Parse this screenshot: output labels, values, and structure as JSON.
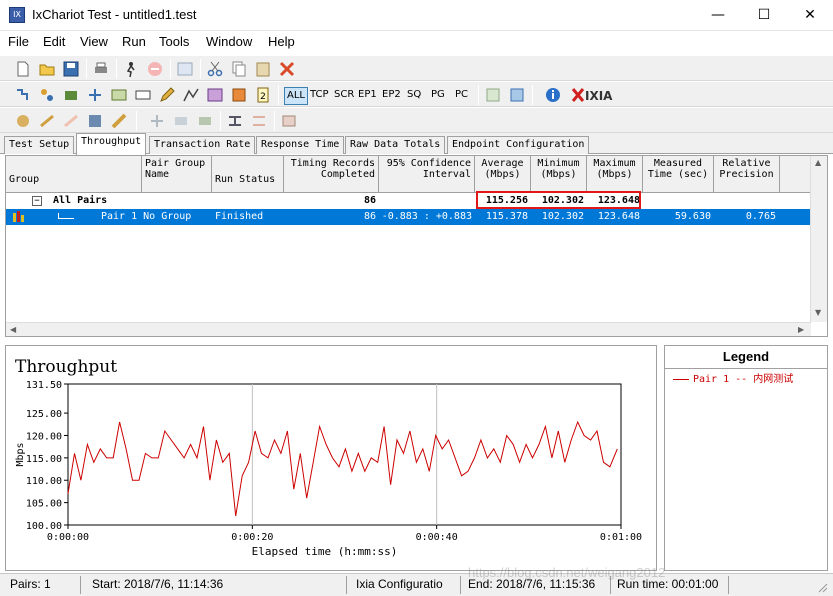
{
  "window": {
    "title": "IxChariot Test - untitled1.test",
    "icon_label": "IX",
    "minimize_glyph": "—",
    "maximize_glyph": "☐",
    "close_glyph": "✕"
  },
  "menu": [
    "File",
    "Edit",
    "View",
    "Run",
    "Tools",
    "Window",
    "Help"
  ],
  "toolbar2": {
    "filters": [
      "ALL",
      "TCP",
      "SCR",
      "EP1",
      "EP2",
      "SQ",
      "PG",
      "PC"
    ],
    "brand": "IXIA"
  },
  "tabs": [
    "Test Setup",
    "Throughput",
    "Transaction Rate",
    "Response Time",
    "Raw Data Totals",
    "Endpoint Configuration"
  ],
  "active_tab": "Throughput",
  "grid": {
    "headers": [
      "Group",
      "Pair Group\nName",
      "Run Status",
      "Timing Records\nCompleted",
      "95% Confidence\nInterval",
      "Average\n(Mbps)",
      "Minimum\n(Mbps)",
      "Maximum\n(Mbps)",
      "Measured\nTime (sec)",
      "Relative\nPrecision"
    ],
    "all_pairs": {
      "expander": "−",
      "label": "All Pairs",
      "records": "86",
      "average": "115.256",
      "minimum": "102.302",
      "maximum": "123.648"
    },
    "pair1": {
      "name": "Pair 1 No Group",
      "status": "Finished",
      "records": "86",
      "confidence": "-0.883 : +0.883",
      "average": "115.378",
      "minimum": "102.302",
      "maximum": "123.648",
      "measured_time": "59.630",
      "precision": "0.765"
    }
  },
  "legend": {
    "title": "Legend",
    "entry": "Pair 1 -- 内网测试"
  },
  "colors": {
    "series": "#cc0000",
    "highlight_box": "#e01818",
    "selection": "#0078d7"
  },
  "status": {
    "pairs": "Pairs: 1",
    "start": "Start: 2018/7/6, 11:14:36",
    "config": "Ixia Configuratio",
    "end": "End: 2018/7/6, 11:15:36",
    "runtime": "Run time: 00:01:00"
  },
  "watermark": "https://blog.csdn.net/weigang2012",
  "chart_data": {
    "type": "line",
    "title": "Throughput",
    "xlabel": "Elapsed time (h:mm:ss)",
    "ylabel": "Mbps",
    "xlim": [
      0,
      60
    ],
    "ylim": [
      100,
      131.5
    ],
    "x_ticks": [
      "0:00:00",
      "0:00:20",
      "0:00:40",
      "0:01:00"
    ],
    "y_ticks": [
      "131.50",
      "125.00",
      "120.00",
      "115.00",
      "110.00",
      "105.00",
      "100.00"
    ],
    "grid": true,
    "series": [
      {
        "name": "Pair 1 -- 内网测试",
        "x": [
          0,
          0.7,
          1.4,
          2.1,
          2.8,
          3.5,
          4.2,
          4.9,
          5.6,
          6.3,
          7.0,
          7.7,
          8.4,
          9.1,
          9.8,
          10.5,
          11.2,
          11.9,
          12.6,
          13.3,
          14.0,
          14.7,
          15.4,
          16.1,
          16.8,
          17.5,
          18.2,
          18.9,
          19.6,
          20.3,
          21.0,
          21.7,
          22.4,
          23.1,
          23.8,
          24.5,
          25.2,
          25.9,
          26.6,
          27.3,
          28.0,
          28.7,
          29.4,
          30.1,
          30.8,
          31.5,
          32.2,
          32.9,
          33.6,
          34.3,
          35.0,
          35.7,
          36.4,
          37.1,
          37.8,
          38.5,
          39.2,
          39.9,
          40.6,
          41.3,
          42.0,
          42.7,
          43.4,
          44.1,
          44.8,
          45.5,
          46.2,
          46.9,
          47.6,
          48.3,
          49.0,
          49.7,
          50.4,
          51.1,
          51.8,
          52.5,
          53.2,
          53.9,
          54.6,
          55.3,
          56.0,
          56.7,
          57.4,
          58.1,
          58.8,
          59.6
        ],
        "y": [
          107,
          116,
          110,
          118,
          114,
          117,
          115,
          115,
          123,
          117,
          110,
          110,
          116,
          115,
          115,
          121,
          119,
          117,
          115,
          118,
          115,
          122,
          110,
          119,
          114,
          116,
          102,
          111,
          114,
          121,
          116,
          115,
          119,
          116,
          121,
          108,
          116,
          106,
          114,
          122,
          118,
          115,
          113,
          117,
          112,
          116,
          112,
          115,
          114,
          122,
          109,
          119,
          116,
          121,
          114,
          117,
          112,
          120,
          117,
          119,
          115,
          111,
          112,
          115,
          119,
          115,
          117,
          114,
          120,
          118,
          114,
          118,
          115,
          118,
          122,
          115,
          121,
          114,
          119,
          123,
          120,
          119,
          121,
          114,
          113,
          117
        ]
      }
    ]
  }
}
